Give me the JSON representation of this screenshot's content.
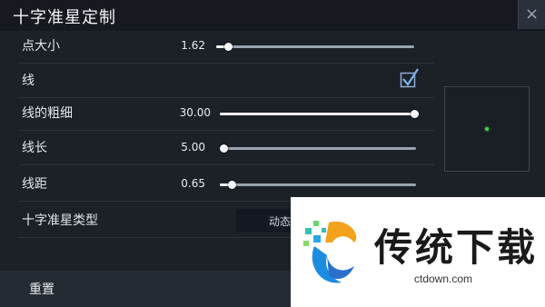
{
  "window": {
    "title": "十字准星定制",
    "close_glyph": "×"
  },
  "settings": {
    "dot_size": {
      "label": "点大小",
      "value_text": "1.62",
      "fraction": 0.06
    },
    "line": {
      "label": "线",
      "checked": true
    },
    "line_thickness": {
      "label": "线的粗细",
      "value_text": "30.00",
      "fraction": 1.0
    },
    "line_length": {
      "label": "线长",
      "value_text": "5.00",
      "fraction": 0.02
    },
    "line_gap": {
      "label": "线距",
      "value_text": "0.65",
      "fraction": 0.06
    },
    "crosshair_type": {
      "label": "十字准星类型",
      "selected": "动态"
    }
  },
  "footer": {
    "reset_label": "重置"
  },
  "preview": {
    "crosshair_color": "#42d24a"
  },
  "watermark": {
    "text": "传统下载",
    "url": "ctdown.com"
  }
}
